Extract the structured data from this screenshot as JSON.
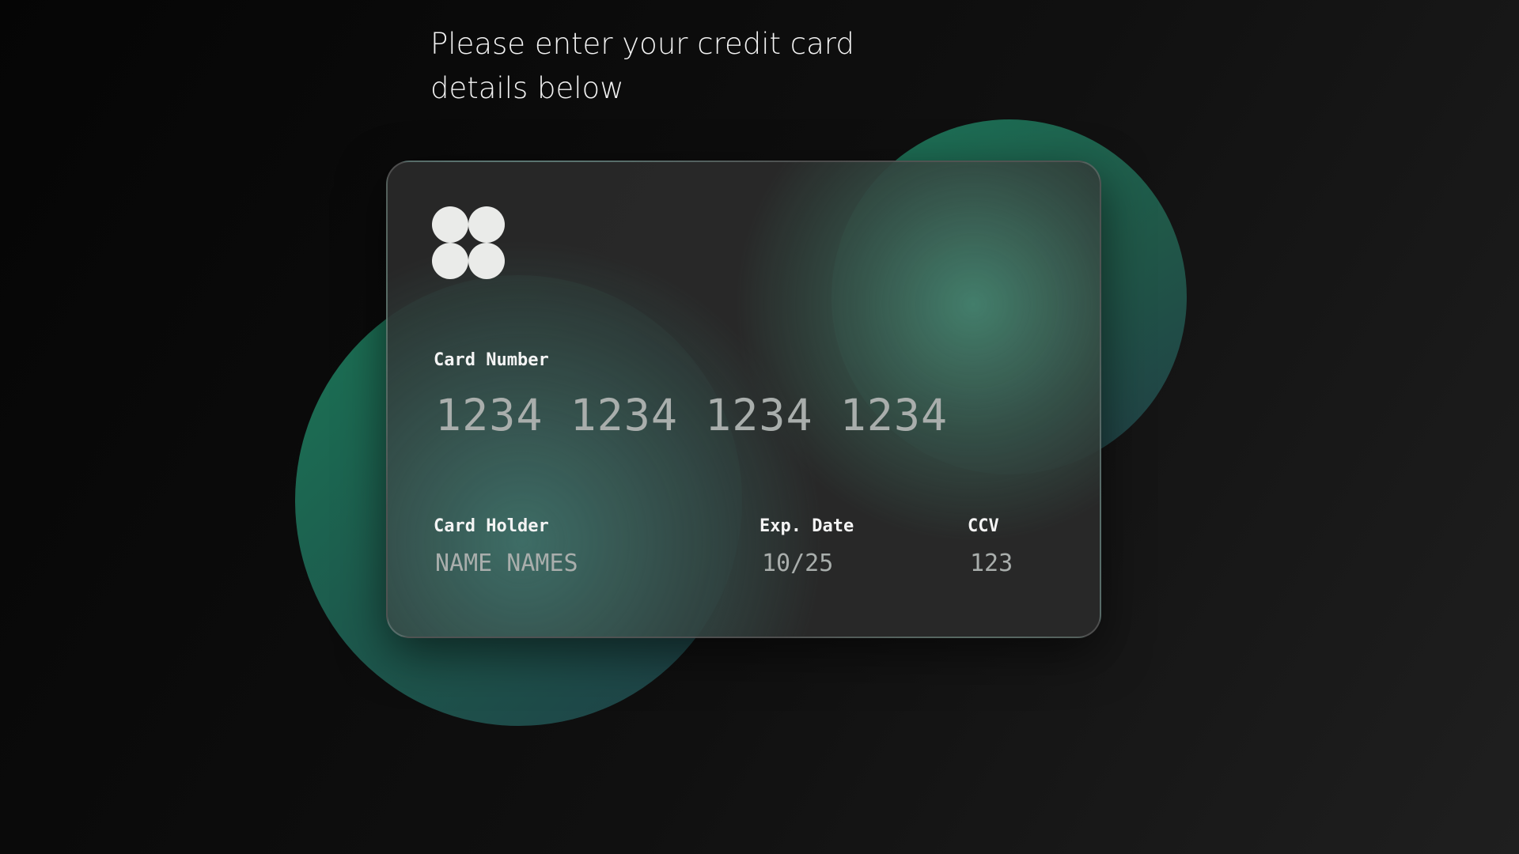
{
  "page": {
    "heading": "Please enter your credit card details below"
  },
  "card": {
    "logo_icon": "four-circles-logo-icon",
    "number_label": "Card Number",
    "number_value": "1234 1234 1234 1234",
    "holder_label": "Card Holder",
    "holder_value": "NAME NAMES",
    "exp_label": "Exp. Date",
    "exp_value": "10/25",
    "ccv_label": "CCV",
    "ccv_value": "123"
  },
  "colors": {
    "background": "#0c0c0c",
    "card_surface": "#2a2a2a",
    "accent_green": "#1b7656",
    "accent_teal": "#213d45",
    "label_text": "#f4f4f4",
    "field_text": "#a9aeac"
  }
}
